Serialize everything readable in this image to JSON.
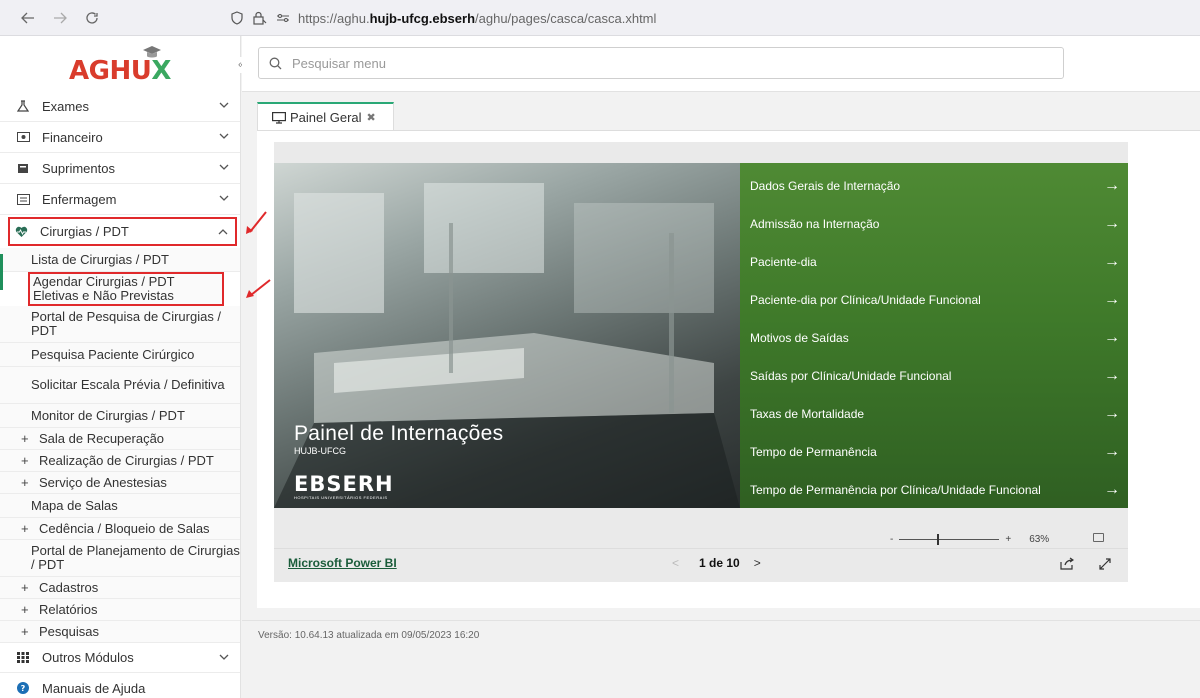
{
  "browser": {
    "url_prefix": "https://aghu.",
    "url_bold": "hujb-ufcg.ebserh",
    "url_suffix": "/aghu/pages/casca/casca.xhtml"
  },
  "logo": {
    "part1": "AGH",
    "part2": "U",
    "part3": "X"
  },
  "sidebar": {
    "top_items": [
      {
        "label": "Exames",
        "icon": "flask-icon"
      },
      {
        "label": "Financeiro",
        "icon": "money-icon"
      },
      {
        "label": "Suprimentos",
        "icon": "box-icon"
      },
      {
        "label": "Enfermagem",
        "icon": "list-icon"
      }
    ],
    "active_item": {
      "label": "Cirurgias / PDT",
      "icon": "heart-icon"
    },
    "sub_items": [
      "Lista de Cirurgias / PDT",
      "Agendar Cirurgias / PDT Eletivas e Não Previstas",
      "Portal de Pesquisa de Cirurgias / PDT",
      "Pesquisa Paciente Cirúrgico",
      "Solicitar Escala Prévia / Definitiva",
      "Monitor de Cirurgias / PDT"
    ],
    "plus_items_a": [
      "Sala de Recuperação",
      "Realização de Cirurgias / PDT",
      "Serviço de Anestesias"
    ],
    "mapa_salas": "Mapa de Salas",
    "cedencia": "Cedência / Bloqueio de Salas",
    "portal_planejamento": "Portal de Planejamento de Cirurgias / PDT",
    "plus_items_b": [
      "Cadastros",
      "Relatórios",
      "Pesquisas"
    ],
    "outros": "Outros Módulos",
    "manuais": "Manuais de Ajuda"
  },
  "search": {
    "placeholder": "Pesquisar menu"
  },
  "tab": {
    "label": "Painel Geral"
  },
  "report": {
    "title": "Painel de Internações",
    "subtitle": "HUJB-UFCG",
    "brand": "EBSERH",
    "brand_sub": "HOSPITAIS UNIVERSITÁRIOS FEDERAIS",
    "menu": [
      "Dados Gerais de Internação",
      "Admissão na Internação",
      "Paciente-dia",
      "Paciente-dia por Clínica/Unidade Funcional",
      "Motivos de Saídas",
      "Saídas por Clínica/Unidade Funcional",
      "Taxas de Mortalidade",
      "Tempo de Permanência",
      "Tempo de Permanência por Clínica/Unidade Funcional"
    ],
    "zoom": "63%",
    "zoom_minus": "-",
    "zoom_plus": "+"
  },
  "pbi": {
    "link": "Microsoft Power BI",
    "page": "1 de 10",
    "prev": "<",
    "next": ">"
  },
  "footer": {
    "version": "Versão: 10.64.13 atualizada em 09/05/2023 16:20"
  },
  "colors": {
    "accent_green": "#2aa876",
    "highlight_red": "#e0292b",
    "report_green": "#3f7a2a"
  }
}
